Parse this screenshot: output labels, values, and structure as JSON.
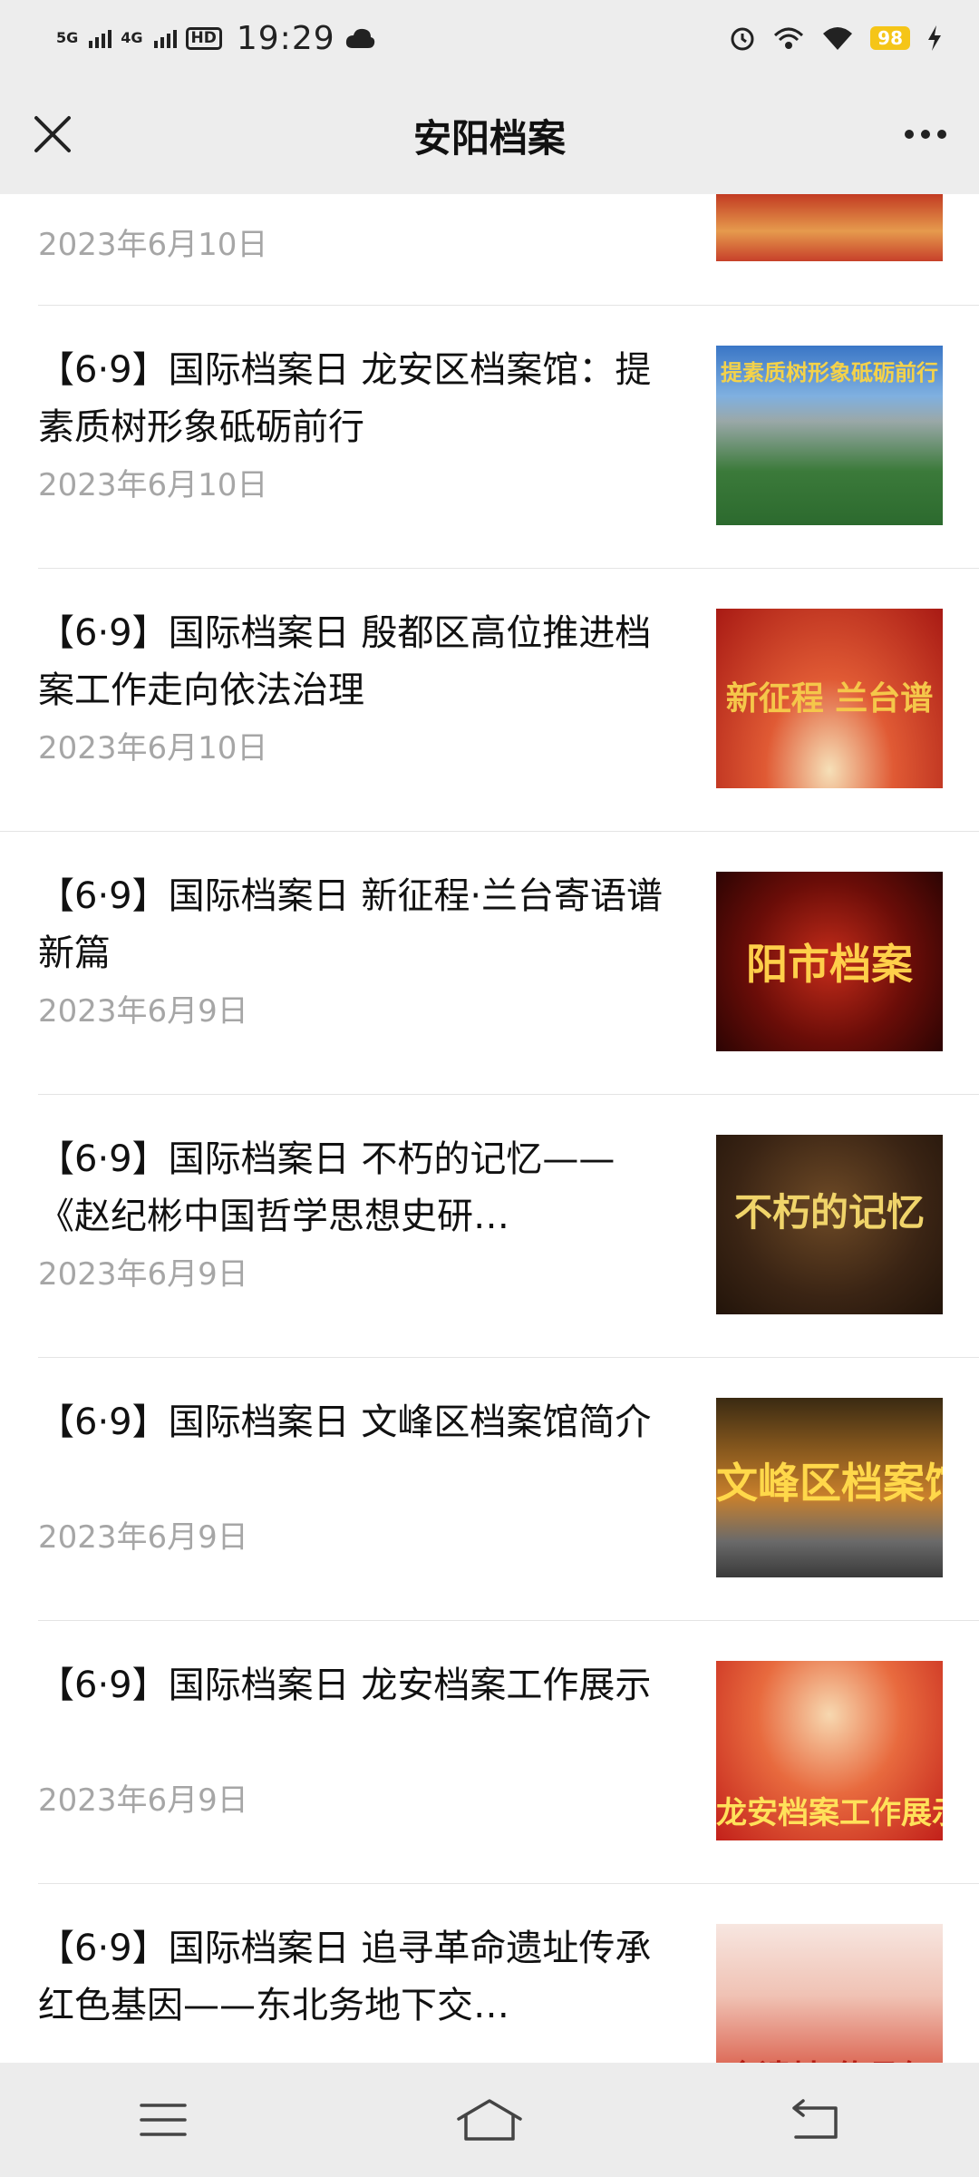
{
  "status_bar": {
    "signal_1": "5G",
    "signal_2": "4G",
    "hd": "HD",
    "time": "19:29",
    "battery": "98"
  },
  "header": {
    "title": "安阳档案"
  },
  "partial_item": {
    "date": "2023年6月10日"
  },
  "articles": [
    {
      "title": "【6·9】国际档案日 龙安区档案馆：提素质树形象砥砺前行",
      "date": "2023年6月10日",
      "thumb_text": "提素质树形象砥砺前行"
    },
    {
      "title": "【6·9】国际档案日 殷都区高位推进档案工作走向依法治理",
      "date": "2023年6月10日",
      "thumb_text": "新征程 兰台谱"
    },
    {
      "title": "【6·9】国际档案日 新征程·兰台寄语谱新篇",
      "date": "2023年6月9日",
      "thumb_text": "阳市档案"
    },
    {
      "title": "【6·9】国际档案日 不朽的记忆——《赵纪彬中国哲学思想史研…",
      "date": "2023年6月9日",
      "thumb_text": "不朽的记忆"
    },
    {
      "title": "【6·9】国际档案日 文峰区档案馆简介",
      "date": "2023年6月9日",
      "thumb_text": "文峰区档案馆"
    },
    {
      "title": "【6·9】国际档案日 龙安档案工作展示",
      "date": "2023年6月9日",
      "thumb_text": "龙安档案工作展示"
    },
    {
      "title": "【6·9】国际档案日 追寻革命遗址传承红色基因——东北务地下交…",
      "date": "",
      "thumb_text": "命遗址 传承红"
    }
  ]
}
